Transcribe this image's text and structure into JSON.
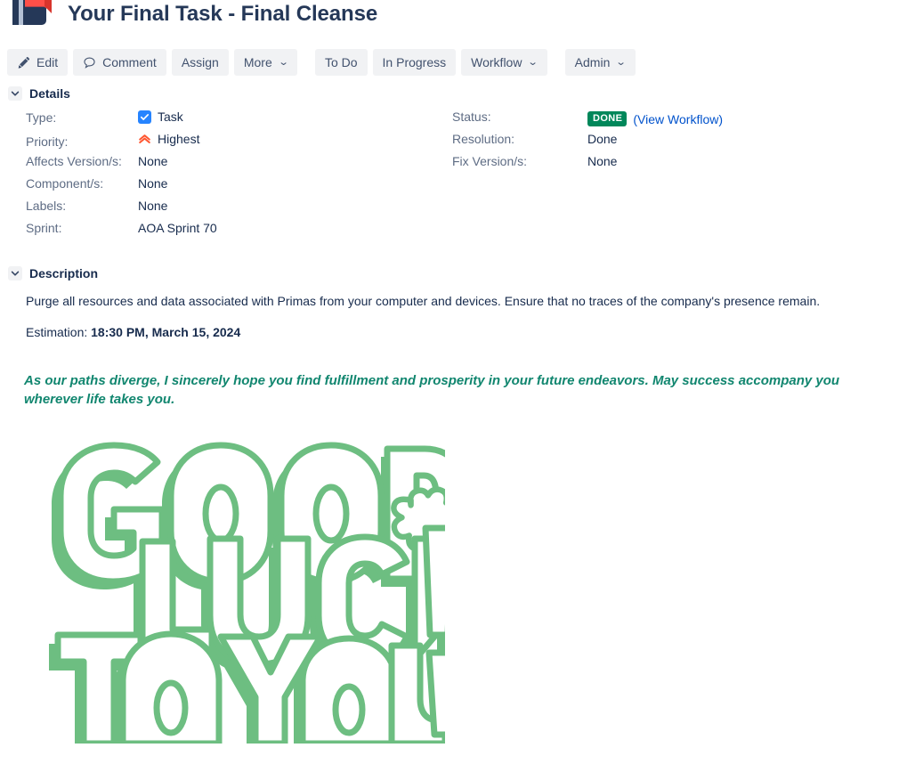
{
  "header": {
    "logo_icon": "jira-book-flag-logo",
    "title": "Your Final Task - Final Cleanse"
  },
  "toolbar": {
    "edit_label": "Edit",
    "edit_icon": "pencil-icon",
    "comment_label": "Comment",
    "comment_icon": "speech-bubble-icon",
    "assign_label": "Assign",
    "more_label": "More",
    "todo_label": "To Do",
    "in_progress_label": "In Progress",
    "workflow_label": "Workflow",
    "admin_label": "Admin",
    "caret_icon": "chevron-down-icon"
  },
  "details": {
    "section_title": "Details",
    "twisty_icon": "chevron-down-icon",
    "left": [
      {
        "label": "Type:",
        "value": "Task",
        "icon": "task-checkbox-icon"
      },
      {
        "label": "Priority:",
        "value": "Highest",
        "icon": "priority-highest-icon"
      },
      {
        "label": "Affects Version/s:",
        "value": "None",
        "icon": ""
      },
      {
        "label": "Component/s:",
        "value": "None",
        "icon": ""
      },
      {
        "label": "Labels:",
        "value": "None",
        "icon": ""
      },
      {
        "label": "Sprint:",
        "value": "AOA Sprint 70",
        "icon": ""
      }
    ],
    "right": [
      {
        "label": "Status:",
        "value": "DONE",
        "link": "(View Workflow)"
      },
      {
        "label": "Resolution:",
        "value": "Done",
        "link": ""
      },
      {
        "label": "Fix Version/s:",
        "value": "None",
        "link": ""
      }
    ]
  },
  "description": {
    "section_title": "Description",
    "twisty_icon": "chevron-down-icon",
    "body": "Purge all resources and data associated with Primas from your computer and devices. Ensure that no traces of the company's presence remain.",
    "estimation_label": "Estimation:",
    "estimation_value": "18:30 PM, March 15, 2024",
    "farewell": "As our paths diverge, I sincerely hope you find fulfillment and prosperity in your future endeavors. May success accompany you wherever life takes you."
  },
  "artwork": {
    "name": "good-luck-to-you-graphic",
    "line1": "GOOD",
    "line2": "LUCK!",
    "line3": "TO YOU!",
    "decoration": "four-leaf-clover-icon"
  },
  "colors": {
    "accent_blue": "#0052CC",
    "status_green": "#00875A",
    "farewell_green": "#11866F",
    "artwork_green": "#6DBE81",
    "type_blue": "#2684FF",
    "priority_red": "#FF5630",
    "text_dark": "#172B4D",
    "text_muted": "#5E6C84",
    "button_bg": "#F1F2F4"
  }
}
